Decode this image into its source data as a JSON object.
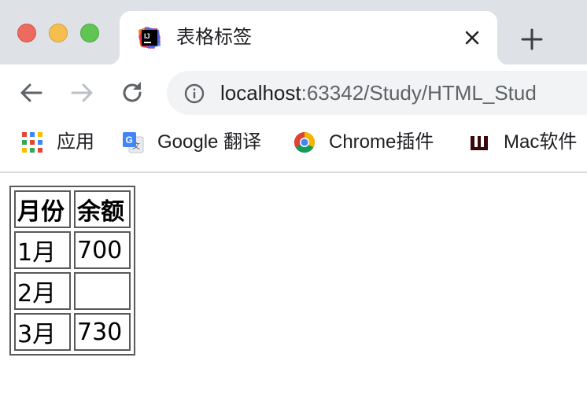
{
  "window": {
    "controls": [
      "close-button",
      "minimize-button",
      "zoom-button"
    ]
  },
  "tab": {
    "title": "表格标签",
    "favicon": "intellij-icon"
  },
  "toolbar": {
    "url_host": "localhost",
    "url_rest": ":63342/Study/HTML_Stud",
    "icons": [
      "back-arrow-icon",
      "forward-arrow-icon",
      "reload-icon",
      "info-icon"
    ]
  },
  "bookmarks": [
    {
      "label": "应用",
      "icon": "apps-grid-icon"
    },
    {
      "label": "Google 翻译",
      "icon": "google-translate-icon"
    },
    {
      "label": "Chrome插件",
      "icon": "chrome-icon"
    },
    {
      "label": "Mac软件",
      "icon": "mac-software-icon"
    }
  ],
  "table": {
    "headers": [
      "月份",
      "余额"
    ],
    "rows": [
      [
        "1月",
        "700"
      ],
      [
        "2月",
        ""
      ],
      [
        "3月",
        "730"
      ]
    ]
  }
}
